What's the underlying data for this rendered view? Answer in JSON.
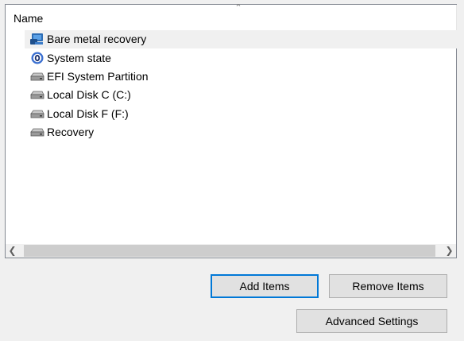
{
  "list": {
    "column_header": "Name",
    "items": [
      {
        "label": "Bare metal recovery",
        "icon": "bare-metal-recovery-icon",
        "selected": true
      },
      {
        "label": "System state",
        "icon": "system-state-icon",
        "selected": false
      },
      {
        "label": "EFI System Partition",
        "icon": "drive-icon",
        "selected": false
      },
      {
        "label": "Local Disk C (C:)",
        "icon": "drive-icon",
        "selected": false
      },
      {
        "label": "Local Disk F (F:)",
        "icon": "drive-icon",
        "selected": false
      },
      {
        "label": "Recovery",
        "icon": "drive-icon",
        "selected": false
      }
    ]
  },
  "buttons": {
    "add_items": "Add Items",
    "remove_items": "Remove Items",
    "advanced_settings": "Advanced Settings"
  },
  "colors": {
    "accent": "#0078d7",
    "selection": "#f0f0f0",
    "button_face": "#e1e1e1"
  }
}
